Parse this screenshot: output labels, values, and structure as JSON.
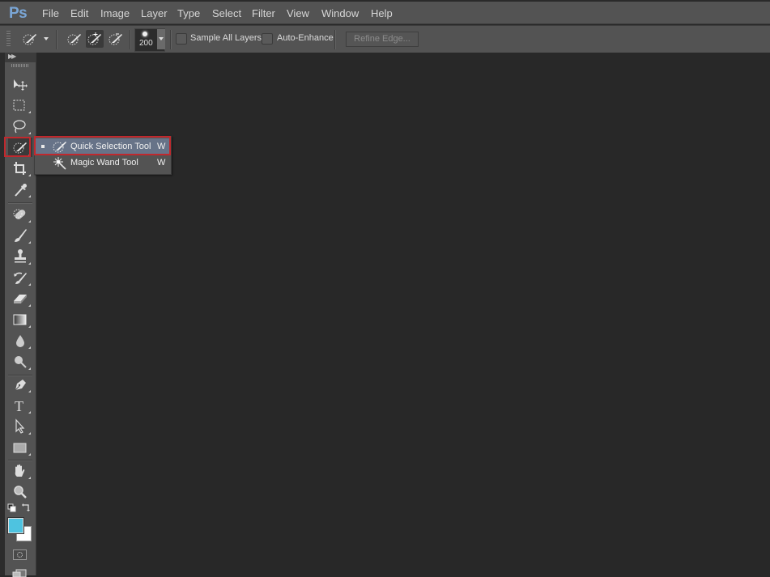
{
  "app": {
    "logo": "Ps",
    "name": "Adobe Photoshop"
  },
  "menubar": {
    "items": [
      "File",
      "Edit",
      "Image",
      "Layer",
      "Type",
      "Select",
      "Filter",
      "View",
      "Window",
      "Help"
    ]
  },
  "options_bar": {
    "tool_preset_icon": "quick-selection-brush-icon",
    "selection_modes": [
      {
        "name": "new-selection",
        "icon": "quick-selection-icon",
        "active": false
      },
      {
        "name": "add-to-selection",
        "icon": "quick-selection-add-icon",
        "active": true
      },
      {
        "name": "subtract-from-selection",
        "icon": "quick-selection-subtract-icon",
        "active": false
      }
    ],
    "brush_size": "200",
    "sample_all_layers": {
      "label": "Sample All Layers",
      "checked": false
    },
    "auto_enhance": {
      "label": "Auto-Enhance",
      "checked": false
    },
    "refine_edge_label": "Refine Edge..."
  },
  "toolbox": {
    "tools": [
      "move-tool",
      "rectangular-marquee-tool",
      "lasso-tool",
      "quick-selection-tool",
      "crop-tool",
      "eyedropper-tool",
      "spot-healing-brush-tool",
      "brush-tool",
      "clone-stamp-tool",
      "history-brush-tool",
      "eraser-tool",
      "gradient-tool",
      "blur-tool",
      "dodge-tool",
      "pen-tool",
      "type-tool",
      "path-selection-tool",
      "rectangle-tool",
      "hand-tool",
      "zoom-tool"
    ],
    "active_tool": "quick-selection-tool",
    "foreground_color": "#4ec3e0",
    "background_color": "#ffffff"
  },
  "flyout": {
    "items": [
      {
        "label": "Quick Selection Tool",
        "shortcut": "W",
        "selected": true
      },
      {
        "label": "Magic Wand Tool",
        "shortcut": "W",
        "selected": false
      }
    ]
  },
  "colors": {
    "highlight_border": "#c0282d",
    "flyout_selected": "#677388"
  }
}
